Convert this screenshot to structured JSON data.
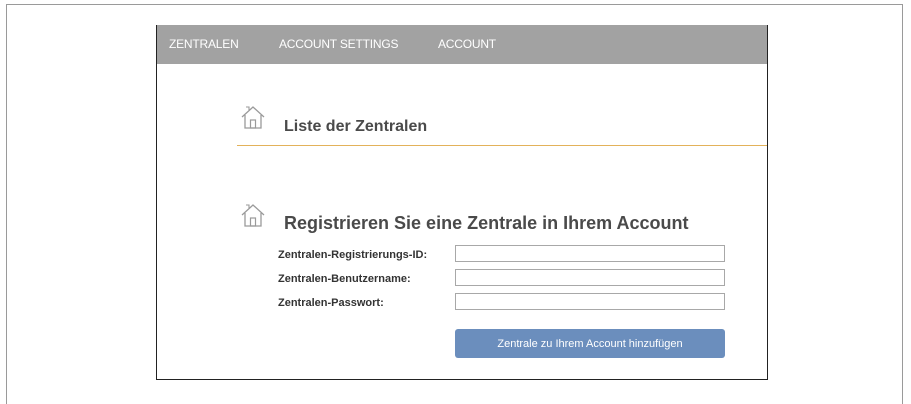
{
  "nav": {
    "items": [
      {
        "label": "ZENTRALEN"
      },
      {
        "label": "ACCOUNT SETTINGS"
      },
      {
        "label": "ACCOUNT"
      }
    ]
  },
  "list_section": {
    "icon": "house-icon",
    "title": "Liste der Zentralen"
  },
  "register_section": {
    "icon": "house-icon",
    "title": "Registrieren Sie eine Zentrale in Ihrem Account",
    "fields": [
      {
        "label": "Zentralen-Registrierungs-ID:",
        "value": ""
      },
      {
        "label": "Zentralen-Benutzername:",
        "value": ""
      },
      {
        "label": "Zentralen-Passwort:",
        "value": ""
      }
    ],
    "submit_label": "Zentrale zu Ihrem Account hinzufügen"
  },
  "colors": {
    "nav_bg": "#a2a2a2",
    "divider": "#e3b25a",
    "button_bg": "#6b8ebd"
  }
}
